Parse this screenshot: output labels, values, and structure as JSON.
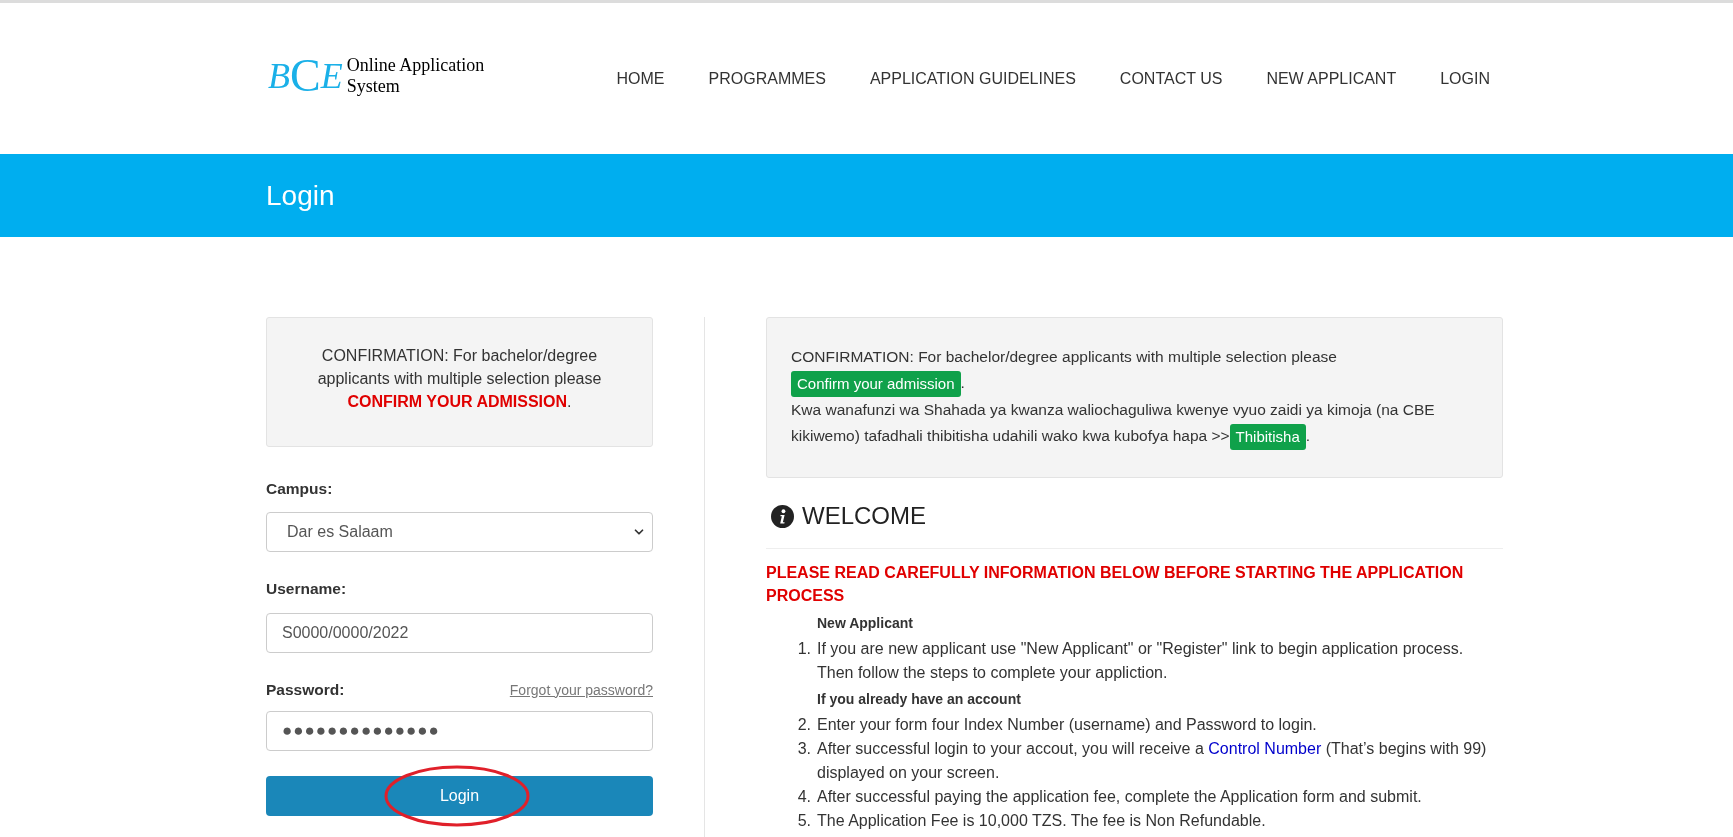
{
  "logo": {
    "mark": [
      "B",
      "C",
      "E"
    ],
    "lines": [
      "Online Application",
      "System"
    ]
  },
  "nav": [
    {
      "label": "HOME"
    },
    {
      "label": "PROGRAMMES"
    },
    {
      "label": "APPLICATION GUIDELINES"
    },
    {
      "label": "CONTACT US"
    },
    {
      "label": "NEW APPLICANT"
    },
    {
      "label": "LOGIN"
    }
  ],
  "banner": {
    "title": "Login"
  },
  "notice_left": {
    "text": "CONFIRMATION: For bachelor/degree applicants with multiple selection please",
    "link": "CONFIRM YOUR ADMISSION",
    "tail": "."
  },
  "form": {
    "campus": {
      "label": "Campus:",
      "value": "Dar es Salaam"
    },
    "username": {
      "label": "Username:",
      "value": "S0000/0000/2022"
    },
    "password": {
      "label": "Password:",
      "value": "●●●●●●●●●●●●●●",
      "forgot": "Forgot your password?"
    },
    "submit": {
      "label": "Login",
      "annotated": true
    }
  },
  "notice_right": [
    {
      "kind": "text",
      "text": "CONFIRMATION: For bachelor/degree applicants with multiple selection please"
    },
    {
      "kind": "button",
      "text": "Confirm your admission"
    },
    {
      "kind": "text",
      "text": "."
    },
    {
      "kind": "break"
    },
    {
      "kind": "text",
      "text": "Kwa wanafunzi wa Shahada ya kwanza waliochaguliwa kwenye vyuo zaidi ya kimoja (na CBE kikiwemo) tafadhali thibitisha udahili wako kwa kubofya hapa >>"
    },
    {
      "kind": "button",
      "text": "Thibitisha"
    },
    {
      "kind": "text",
      "text": "."
    }
  ],
  "welcome": {
    "title": "WELCOME",
    "warning": "PLEASE READ CAREFULLY INFORMATION BELOW BEFORE STARTING THE APPLICATION PROCESS",
    "items": [
      {
        "kind": "heading",
        "text": "New Applicant"
      },
      {
        "kind": "step",
        "number": "1.",
        "parts": [
          {
            "kind": "text",
            "text": "If you are new applicant use \"New Applicant\" or \"Register\" link to begin application process. Then follow the steps to complete your appliction."
          }
        ]
      },
      {
        "kind": "heading",
        "text": "If you already have an account"
      },
      {
        "kind": "step",
        "number": "2.",
        "parts": [
          {
            "kind": "text",
            "text": "Enter your form four Index Number (username) and Password to login."
          }
        ]
      },
      {
        "kind": "step",
        "number": "3.",
        "parts": [
          {
            "kind": "text",
            "text": "After successful login to your accout, you will receive a "
          },
          {
            "kind": "link",
            "text": "Control Number"
          },
          {
            "kind": "text",
            "text": " (That’s begins with 99) displayed on your screen."
          }
        ]
      },
      {
        "kind": "step",
        "number": "4.",
        "parts": [
          {
            "kind": "text",
            "text": "After successful paying the application fee, complete the Application form and submit."
          }
        ]
      },
      {
        "kind": "step",
        "number": "5.",
        "parts": [
          {
            "kind": "text",
            "text": "The Application Fee is 10,000 TZS. The fee is Non Refundable."
          }
        ]
      }
    ]
  }
}
